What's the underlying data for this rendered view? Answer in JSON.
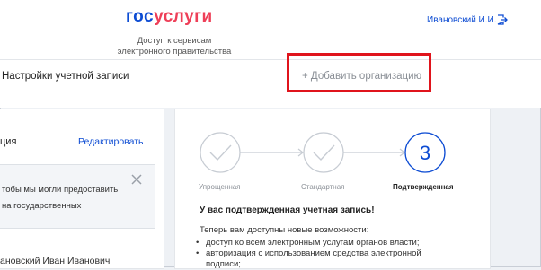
{
  "header": {
    "logo_part1": "гос",
    "logo_part2": "услуги",
    "tagline_line1": "Доступ к сервисам",
    "tagline_line2": "электронного правительства",
    "user_name": "Ивановский И.И."
  },
  "toolbar": {
    "settings_title": "Настройки учетной записи",
    "add_org_label": "+ Добавить организацию"
  },
  "left_card": {
    "title": "ция",
    "edit_label": "Редактировать",
    "note_line1": "тобы мы могли предоставить",
    "note_line2": "на государственных",
    "person_name": "ановский Иван Иванович"
  },
  "right_card": {
    "steps": [
      {
        "label": "Упрощенная",
        "state": "done"
      },
      {
        "label": "Стандартная",
        "state": "done"
      },
      {
        "label": "Подтвержденная",
        "state": "current",
        "number": "3"
      }
    ],
    "status_title": "У вас подтвержденная учетная запись!",
    "intro": "Теперь вам доступны новые возможности:",
    "bullets": [
      "доступ ко всем электронным услугам органов власти;",
      "авторизация с использованием средства электронной",
      "подписи;"
    ]
  },
  "colors": {
    "brand_blue": "#0d4cd3",
    "brand_red": "#ee3f58",
    "highlight_red": "#e0141c",
    "step_grey": "#c7ccd3"
  },
  "icons": [
    "logout-icon",
    "close-icon",
    "checkmark-icon",
    "arrow-right-icon"
  ]
}
